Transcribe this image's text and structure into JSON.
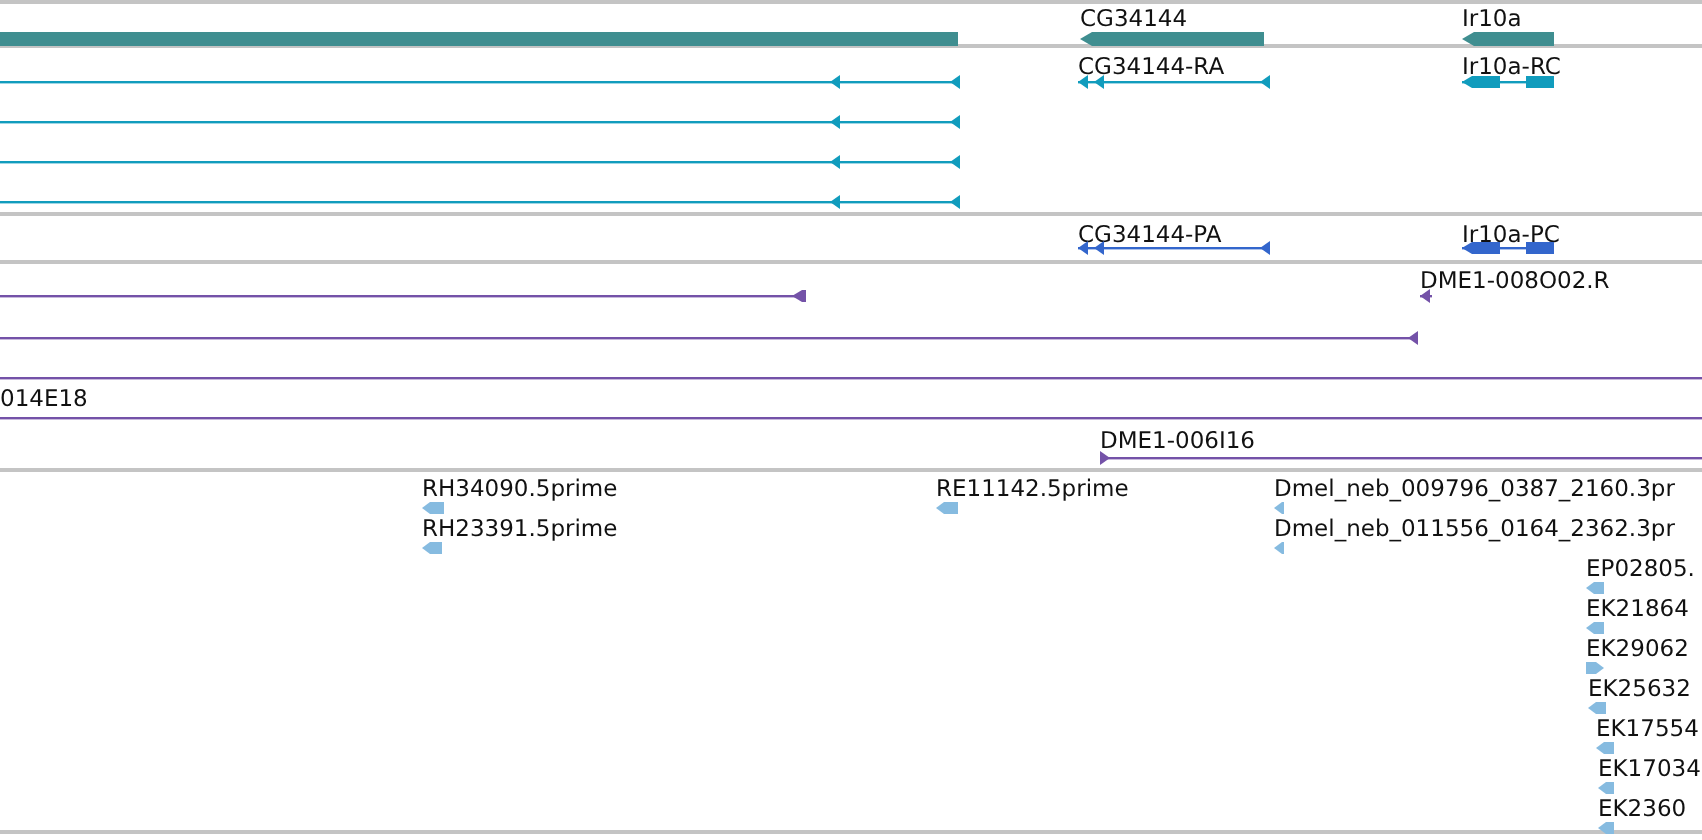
{
  "tracks": [
    {
      "color": "#3f8e90",
      "features": [
        {
          "kind": "bar"
        },
        {
          "kind": "bar",
          "label": "CG34144",
          "reverse": true
        },
        {
          "kind": "bar",
          "label": "Ir10a",
          "reverse": true
        }
      ]
    },
    {
      "color": "#119cbd",
      "features": [
        {
          "kind": "transcript",
          "reverse": true
        },
        {
          "kind": "transcript",
          "reverse": true
        },
        {
          "kind": "transcript",
          "reverse": true
        },
        {
          "kind": "transcript",
          "reverse": true
        },
        {
          "kind": "transcript",
          "label": "CG34144-RA",
          "reverse": true
        },
        {
          "kind": "transcript",
          "label": "Ir10a-RC",
          "reverse": true
        }
      ]
    },
    {
      "color": "#3366cc",
      "features": [
        {
          "kind": "transcript",
          "label": "CG34144-PA",
          "reverse": true
        },
        {
          "kind": "transcript",
          "label": "Ir10a-PC",
          "reverse": true
        }
      ]
    },
    {
      "color": "#7452a8",
      "features": [
        {
          "kind": "transcript",
          "reverse": true
        },
        {
          "kind": "transcript",
          "label": "DME1-008O02.R",
          "reverse": true
        },
        {
          "kind": "transcript",
          "reverse": true
        },
        {
          "kind": "transcript"
        },
        {
          "kind": "transcript",
          "label": "014E18"
        },
        {
          "kind": "transcript",
          "label": "DME1-006I16",
          "reverse": false
        }
      ]
    },
    {
      "color": "#86bbe0",
      "features": [
        {
          "kind": "read",
          "label": "RH34090.5prime",
          "reverse": true
        },
        {
          "kind": "read",
          "label": "RH23391.5prime",
          "reverse": true
        },
        {
          "kind": "read",
          "label": "RE11142.5prime",
          "reverse": true
        },
        {
          "kind": "read",
          "label": "Dmel_neb_009796_0387_2160.3pr",
          "reverse": true
        },
        {
          "kind": "read",
          "label": "Dmel_neb_011556_0164_2362.3pr",
          "reverse": true
        },
        {
          "kind": "read",
          "label": "EP02805.",
          "reverse": true
        },
        {
          "kind": "read",
          "label": "EK21864",
          "reverse": true
        },
        {
          "kind": "read",
          "label": "EK29062",
          "reverse": false
        },
        {
          "kind": "read",
          "label": "EK25632",
          "reverse": true
        },
        {
          "kind": "read",
          "label": "EK17554",
          "reverse": true
        },
        {
          "kind": "read",
          "label": "EK17034",
          "reverse": true
        },
        {
          "kind": "read",
          "label": "EK2360",
          "reverse": true
        }
      ]
    }
  ]
}
